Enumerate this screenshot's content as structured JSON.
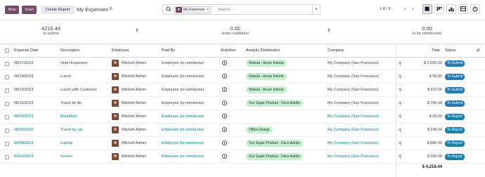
{
  "toolbar": {
    "new_label": "New",
    "scan_label": "Scan",
    "create_report_label": "Create Report",
    "title": "My Expenses",
    "gear_icon": "gear-icon"
  },
  "search": {
    "facet_label": "My Expenses",
    "facet_icon": "filter-icon",
    "placeholder": "Search...",
    "value": ""
  },
  "pager": {
    "range": "1-8 / 8"
  },
  "summary": [
    {
      "value": "4216.44",
      "label": "to submit"
    },
    {
      "value": "0.00",
      "label": "under validation"
    },
    {
      "value": "0.00",
      "label": "to be reimbursed"
    }
  ],
  "columns": {
    "date": "Expense Date",
    "description": "Description",
    "employee": "Employee",
    "paid_by": "Paid By",
    "activities": "Activities",
    "analytic": "Analytic Distribution",
    "company": "Company",
    "total": "Total",
    "status": "Status"
  },
  "rows": [
    {
      "date": "08/17/2023",
      "description": "Hotel Expenses",
      "employee": "Mitchell Admin",
      "paid_by": "Employee (to reimburse)",
      "analytic": "Nebula - Azure Interior",
      "company": "My Company (San Francisco)",
      "total": "$ 2,000.00",
      "status": "To Submit",
      "link": false
    },
    {
      "date": "08/15/2023",
      "description": "Lunch",
      "employee": "Mitchell Admin",
      "paid_by": "Employee (to reimburse)",
      "analytic": "Nebula - Azure Interior",
      "company": "My Company (San Francisco)",
      "total": "$ 56.80",
      "status": "To Submit",
      "link": false
    },
    {
      "date": "08/13/2023",
      "description": "Lunch with Customer",
      "employee": "Mitchell Admin",
      "paid_by": "Employee (to reimburse)",
      "analytic": "Nebula - Azure Interior",
      "company": "My Company (San Francisco)",
      "total": "$ 152.00",
      "status": "To Submit",
      "link": false
    },
    {
      "date": "08/12/2023",
      "description": "Travel by Air",
      "employee": "Mitchell Admin",
      "paid_by": "Employee (to reimburse)",
      "analytic": "Our Super Product - Deco Addict",
      "company": "My Company (San Francisco)",
      "total": "$ 700.00",
      "status": "To Submit",
      "link": false
    },
    {
      "date": "08/09/2023",
      "description": "Breakfast",
      "employee": "Mitchell Admin",
      "paid_by": "Employee (to reimburse)",
      "analytic": "",
      "company": "My Company (San Francisco)",
      "total": "$ 20.00",
      "status": "To Report",
      "link": true
    },
    {
      "date": "08/05/2023",
      "description": "Travel by car",
      "employee": "Mitchell Admin",
      "paid_by": "Employee (to reimburse)",
      "analytic": "Office Design",
      "company": "My Company (San Francisco)",
      "total": "$ 108.64",
      "status": "To Report",
      "link": true
    },
    {
      "date": "04/08/2023",
      "description": "Laptop",
      "employee": "Mitchell Admin",
      "paid_by": "Employee (to reimburse)",
      "analytic": "Our Super Product - Deco Addict",
      "company": "My Company (San Francisco)",
      "total": "$ 889.00",
      "status": "To Report",
      "link": true
    },
    {
      "date": "04/03/2023",
      "description": "Screen",
      "employee": "Mitchell Admin",
      "paid_by": "Employee (to reimburse)",
      "analytic": "Our Super Product - Deco Addict",
      "company": "My Company (San Francisco)",
      "total": "$ 290.00",
      "status": "To Report",
      "link": true
    }
  ],
  "footer": {
    "grand_total": "$ 4,216.44"
  },
  "colors": {
    "brand": "#714B67",
    "link": "#017e84",
    "tag_green": "#c6f0cf",
    "status_blue": "#2479b6"
  }
}
